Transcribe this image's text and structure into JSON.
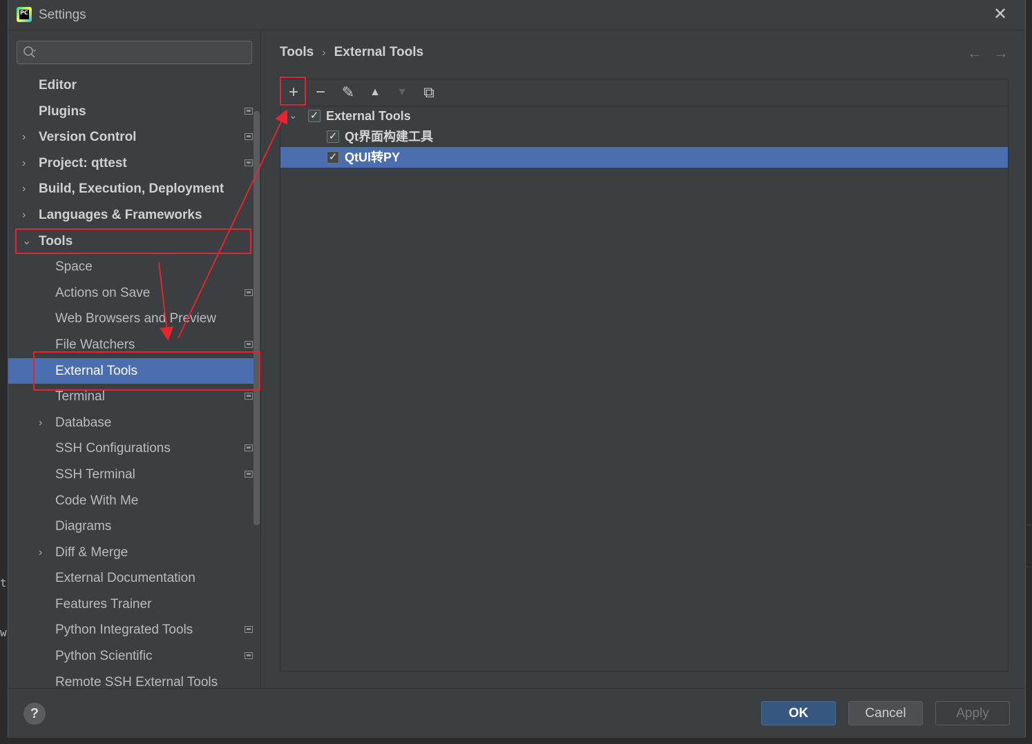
{
  "window": {
    "title": "Settings",
    "app_icon": "pycharm-icon",
    "app_icon_text": "PC"
  },
  "search": {
    "placeholder": "",
    "value": ""
  },
  "sidebar": {
    "items": [
      {
        "label": "Editor",
        "level": 0,
        "bold": true,
        "arrow": "",
        "project": false
      },
      {
        "label": "Plugins",
        "level": 0,
        "bold": true,
        "arrow": "",
        "project": true
      },
      {
        "label": "Version Control",
        "level": 0,
        "bold": true,
        "arrow": "›",
        "project": true
      },
      {
        "label": "Project: qttest",
        "level": 0,
        "bold": true,
        "arrow": "›",
        "project": true
      },
      {
        "label": "Build, Execution, Deployment",
        "level": 0,
        "bold": true,
        "arrow": "›",
        "project": false
      },
      {
        "label": "Languages & Frameworks",
        "level": 0,
        "bold": true,
        "arrow": "›",
        "project": false
      },
      {
        "label": "Tools",
        "level": 0,
        "bold": true,
        "arrow": "⌄",
        "project": false
      },
      {
        "label": "Space",
        "level": 1,
        "bold": false,
        "arrow": "",
        "project": false
      },
      {
        "label": "Actions on Save",
        "level": 1,
        "bold": false,
        "arrow": "",
        "project": true
      },
      {
        "label": "Web Browsers and Preview",
        "level": 1,
        "bold": false,
        "arrow": "",
        "project": false
      },
      {
        "label": "File Watchers",
        "level": 1,
        "bold": false,
        "arrow": "",
        "project": true
      },
      {
        "label": "External Tools",
        "level": 1,
        "bold": false,
        "arrow": "",
        "project": false,
        "selected": true
      },
      {
        "label": "Terminal",
        "level": 1,
        "bold": false,
        "arrow": "",
        "project": true
      },
      {
        "label": "Database",
        "level": 1,
        "bold": false,
        "arrow": "›",
        "project": false
      },
      {
        "label": "SSH Configurations",
        "level": 1,
        "bold": false,
        "arrow": "",
        "project": true
      },
      {
        "label": "SSH Terminal",
        "level": 1,
        "bold": false,
        "arrow": "",
        "project": true
      },
      {
        "label": "Code With Me",
        "level": 1,
        "bold": false,
        "arrow": "",
        "project": false
      },
      {
        "label": "Diagrams",
        "level": 1,
        "bold": false,
        "arrow": "",
        "project": false
      },
      {
        "label": "Diff & Merge",
        "level": 1,
        "bold": false,
        "arrow": "›",
        "project": false
      },
      {
        "label": "External Documentation",
        "level": 1,
        "bold": false,
        "arrow": "",
        "project": false
      },
      {
        "label": "Features Trainer",
        "level": 1,
        "bold": false,
        "arrow": "",
        "project": false
      },
      {
        "label": "Python Integrated Tools",
        "level": 1,
        "bold": false,
        "arrow": "",
        "project": true
      },
      {
        "label": "Python Scientific",
        "level": 1,
        "bold": false,
        "arrow": "",
        "project": true
      },
      {
        "label": "Remote SSH External Tools",
        "level": 1,
        "bold": false,
        "arrow": "",
        "project": false
      }
    ]
  },
  "breadcrumb": {
    "parent": "Tools",
    "separator": "›",
    "current": "External Tools"
  },
  "history": {
    "back": "←",
    "forward": "→"
  },
  "toolbar": {
    "add": "+",
    "remove": "−",
    "edit": "✎",
    "move_up": "▲",
    "move_down": "▼",
    "copy": "⧉"
  },
  "tree": {
    "group": {
      "label": "External Tools",
      "checked": true,
      "expanded": true
    },
    "items": [
      {
        "label": "Qt界面构建工具",
        "checked": true,
        "selected": false
      },
      {
        "label": "QtUI转PY",
        "checked": true,
        "selected": true
      }
    ]
  },
  "footer": {
    "help": "?",
    "ok": "OK",
    "cancel": "Cancel",
    "apply": "Apply"
  },
  "background_chars": [
    "t",
    "w"
  ],
  "colors": {
    "selection": "#4b6eaf",
    "annotation": "#e8232d",
    "primary_button": "#365880"
  }
}
